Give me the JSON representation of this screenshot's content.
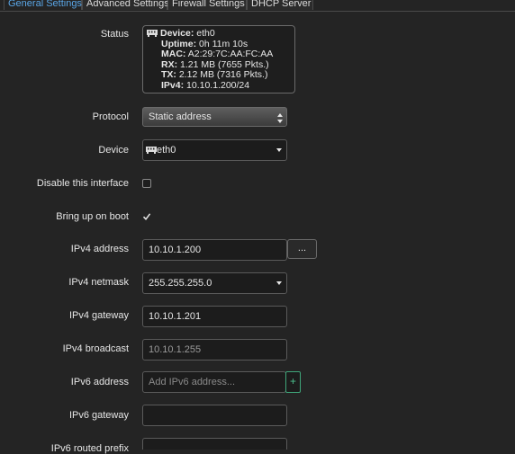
{
  "tabs": [
    {
      "label": "General Settings",
      "active": true
    },
    {
      "label": "Advanced Settings",
      "active": false
    },
    {
      "label": "Firewall Settings",
      "active": false
    },
    {
      "label": "DHCP Server",
      "active": false
    }
  ],
  "status": {
    "label": "Status",
    "device_key": "Device:",
    "device_val": "eth0",
    "uptime_key": "Uptime:",
    "uptime_val": "0h 11m 10s",
    "mac_key": "MAC:",
    "mac_val": "A2:29:7C:AA:FC:AA",
    "rx_key": "RX:",
    "rx_val": "1.21 MB (7655 Pkts.)",
    "tx_key": "TX:",
    "tx_val": "2.12 MB (7316 Pkts.)",
    "ipv4_key": "IPv4:",
    "ipv4_val": "10.10.1.200/24",
    "icon": "network-port-icon"
  },
  "protocol": {
    "label": "Protocol",
    "value": "Static address"
  },
  "device": {
    "label": "Device",
    "value": "eth0",
    "icon": "network-port-icon"
  },
  "disable_interface": {
    "label": "Disable this interface",
    "checked": false
  },
  "bring_up_on_boot": {
    "label": "Bring up on boot",
    "checked": true
  },
  "ipv4_address": {
    "label": "IPv4 address",
    "value": "10.10.1.200",
    "button": "..."
  },
  "ipv4_netmask": {
    "label": "IPv4 netmask",
    "value": "255.255.255.0"
  },
  "ipv4_gateway": {
    "label": "IPv4 gateway",
    "value": "10.10.1.201"
  },
  "ipv4_broadcast": {
    "label": "IPv4 broadcast",
    "placeholder": "10.10.1.255"
  },
  "ipv6_address": {
    "label": "IPv6 address",
    "placeholder": "Add IPv6 address...",
    "button": "+"
  },
  "ipv6_gateway": {
    "label": "IPv6 gateway",
    "value": ""
  },
  "ipv6_routed_prefix": {
    "label": "IPv6 routed prefix",
    "value": ""
  },
  "colors": {
    "accent_tab": "#5aa6e6",
    "add_button": "#4cc08e",
    "background": "#242424"
  }
}
